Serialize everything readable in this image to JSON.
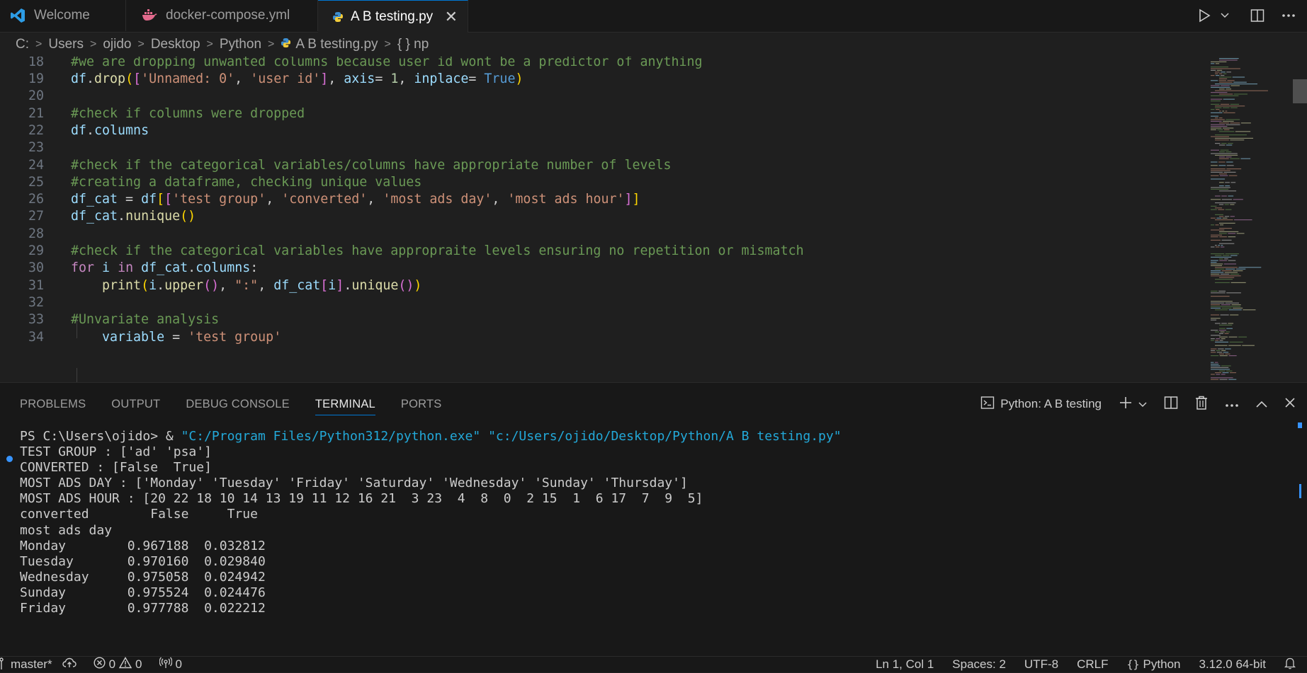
{
  "tabs": [
    {
      "label": "Welcome",
      "icon": "vscode-logo-icon"
    },
    {
      "label": "docker-compose.yml",
      "icon": "docker-icon"
    },
    {
      "label": "A B testing.py",
      "icon": "python-icon",
      "active": true
    }
  ],
  "tab_close": "✕",
  "breadcrumb": [
    "C:",
    "Users",
    "ojido",
    "Desktop",
    "Python",
    "A B testing.py",
    "{ } np"
  ],
  "editor": {
    "lines": [
      {
        "n": "18",
        "tokens": [
          [
            "cm",
            "#we are dropping unwanted columns because user id wont be a predictor of anything"
          ]
        ]
      },
      {
        "n": "19",
        "tokens": [
          [
            "var",
            "df"
          ],
          [
            "code",
            "."
          ],
          [
            "fn",
            "drop"
          ],
          [
            "br1",
            "("
          ],
          [
            "br2",
            "["
          ],
          [
            "str",
            "'Unnamed: 0'"
          ],
          [
            "code",
            ", "
          ],
          [
            "str",
            "'user id'"
          ],
          [
            "br2",
            "]"
          ],
          [
            "code",
            ", "
          ],
          [
            "var",
            "axis"
          ],
          [
            "code",
            "= "
          ],
          [
            "num",
            "1"
          ],
          [
            "code",
            ", "
          ],
          [
            "var",
            "inplace"
          ],
          [
            "code",
            "= "
          ],
          [
            "bool",
            "True"
          ],
          [
            "br1",
            ")"
          ]
        ]
      },
      {
        "n": "20",
        "tokens": []
      },
      {
        "n": "21",
        "tokens": [
          [
            "cm",
            "#check if columns were dropped"
          ]
        ]
      },
      {
        "n": "22",
        "tokens": [
          [
            "var",
            "df"
          ],
          [
            "code",
            "."
          ],
          [
            "var",
            "columns"
          ]
        ]
      },
      {
        "n": "23",
        "tokens": []
      },
      {
        "n": "24",
        "tokens": [
          [
            "cm",
            "#check if the categorical variables/columns have appropriate number of levels"
          ]
        ]
      },
      {
        "n": "25",
        "tokens": [
          [
            "cm",
            "#creating a dataframe, checking unique values"
          ]
        ]
      },
      {
        "n": "26",
        "tokens": [
          [
            "var",
            "df_cat"
          ],
          [
            "code",
            " = "
          ],
          [
            "var",
            "df"
          ],
          [
            "br1",
            "["
          ],
          [
            "br2",
            "["
          ],
          [
            "str",
            "'test group'"
          ],
          [
            "code",
            ", "
          ],
          [
            "str",
            "'converted'"
          ],
          [
            "code",
            ", "
          ],
          [
            "str",
            "'most ads day'"
          ],
          [
            "code",
            ", "
          ],
          [
            "str",
            "'most ads hour'"
          ],
          [
            "br2",
            "]"
          ],
          [
            "br1",
            "]"
          ]
        ]
      },
      {
        "n": "27",
        "tokens": [
          [
            "var",
            "df_cat"
          ],
          [
            "code",
            "."
          ],
          [
            "fn",
            "nunique"
          ],
          [
            "br1",
            "()"
          ]
        ]
      },
      {
        "n": "28",
        "tokens": []
      },
      {
        "n": "29",
        "tokens": [
          [
            "cm",
            "#check if the categorical variables have appropraite levels ensuring no repetition or mismatch"
          ]
        ]
      },
      {
        "n": "30",
        "tokens": [
          [
            "kw",
            "for"
          ],
          [
            "code",
            " "
          ],
          [
            "var",
            "i"
          ],
          [
            "code",
            " "
          ],
          [
            "kw",
            "in"
          ],
          [
            "code",
            " "
          ],
          [
            "var",
            "df_cat"
          ],
          [
            "code",
            "."
          ],
          [
            "var",
            "columns"
          ],
          [
            "code",
            ":"
          ]
        ]
      },
      {
        "n": "31",
        "tokens": [
          [
            "code",
            "    "
          ],
          [
            "fn",
            "print"
          ],
          [
            "br1",
            "("
          ],
          [
            "var",
            "i"
          ],
          [
            "code",
            "."
          ],
          [
            "fn",
            "upper"
          ],
          [
            "br2",
            "()"
          ],
          [
            "code",
            ", "
          ],
          [
            "str",
            "\":\""
          ],
          [
            "code",
            ", "
          ],
          [
            "var",
            "df_cat"
          ],
          [
            "br2",
            "["
          ],
          [
            "var",
            "i"
          ],
          [
            "br2",
            "]"
          ],
          [
            "code",
            "."
          ],
          [
            "fn",
            "unique"
          ],
          [
            "br2",
            "()"
          ],
          [
            "br1",
            ")"
          ]
        ]
      },
      {
        "n": "32",
        "tokens": []
      },
      {
        "n": "33",
        "tokens": [
          [
            "cm",
            "#Unvariate analysis"
          ]
        ]
      },
      {
        "n": "34",
        "tokens": [
          [
            "code",
            "    "
          ],
          [
            "var",
            "variable"
          ],
          [
            "code",
            " = "
          ],
          [
            "str",
            "'test group'"
          ]
        ]
      }
    ]
  },
  "panel": {
    "tabs": [
      "PROBLEMS",
      "OUTPUT",
      "DEBUG CONSOLE",
      "TERMINAL",
      "PORTS"
    ],
    "active_tab": "TERMINAL",
    "terminal_name": "Python: A B testing"
  },
  "terminal": {
    "prompt": "PS C:\\Users\\ojido> & ",
    "cmd_python": "\"C:/Program Files/Python312/python.exe\"",
    "cmd_script": "\"c:/Users/ojido/Desktop/Python/A B testing.py\"",
    "output": [
      "TEST GROUP : ['ad' 'psa']",
      "CONVERTED : [False  True]",
      "MOST ADS DAY : ['Monday' 'Tuesday' 'Friday' 'Saturday' 'Wednesday' 'Sunday' 'Thursday']",
      "MOST ADS HOUR : [20 22 18 10 14 13 19 11 12 16 21  3 23  4  8  0  2 15  1  6 17  7  9  5]",
      "converted        False     True",
      "most ads day",
      "Monday        0.967188  0.032812",
      "Tuesday       0.970160  0.029840",
      "Wednesday     0.975058  0.024942",
      "Sunday        0.975524  0.024476",
      "Friday        0.977788  0.022212"
    ]
  },
  "status": {
    "branch": "master*",
    "errors": "0",
    "warnings": "0",
    "ports": "0",
    "position": "Ln 1, Col 1",
    "spaces": "Spaces: 2",
    "encoding": "UTF-8",
    "eol": "CRLF",
    "language": "Python",
    "interpreter": "3.12.0 64-bit"
  },
  "colors": {
    "accent": "#0078d4",
    "comment": "#6a9955",
    "string": "#ce9178",
    "keyword": "#c586c0"
  }
}
